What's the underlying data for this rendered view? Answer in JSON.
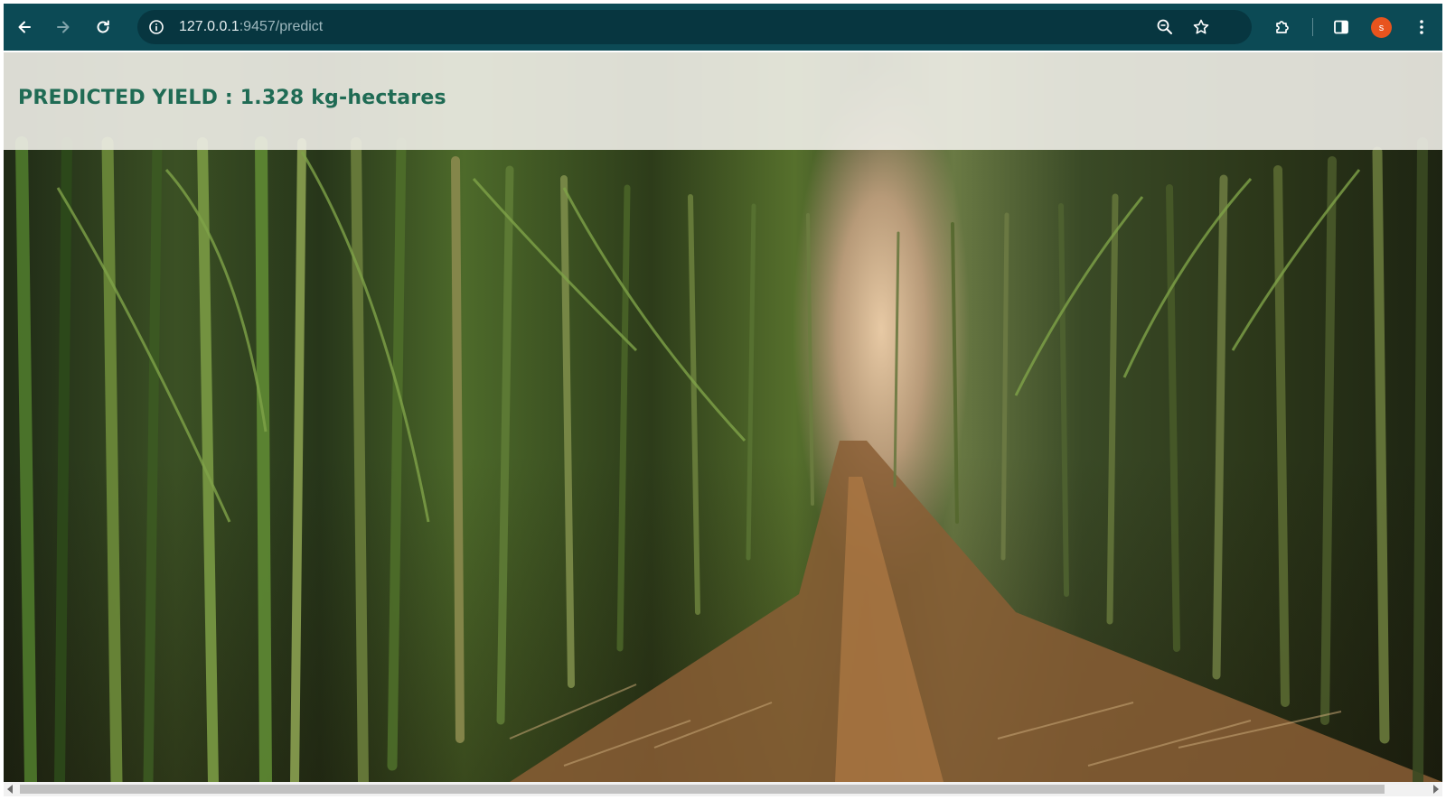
{
  "browser": {
    "url_host": "127.0.0.1",
    "url_rest": ":9457/predict",
    "profile_initial": "s",
    "colors": {
      "toolbar": "#0c4a55",
      "omnibox": "#073640",
      "avatar": "#e8541e"
    },
    "icons": [
      "back-arrow-icon",
      "forward-arrow-icon",
      "reload-icon",
      "site-info-icon",
      "zoom-out-icon",
      "bookmark-star-icon",
      "extensions-puzzle-icon",
      "side-panel-icon",
      "kebab-menu-icon"
    ]
  },
  "page": {
    "result_text": "PREDICTED YIELD : 1.328 kg-hectares",
    "result_color": "#1f6b54",
    "background_image": "sugarcane field with dirt path"
  }
}
